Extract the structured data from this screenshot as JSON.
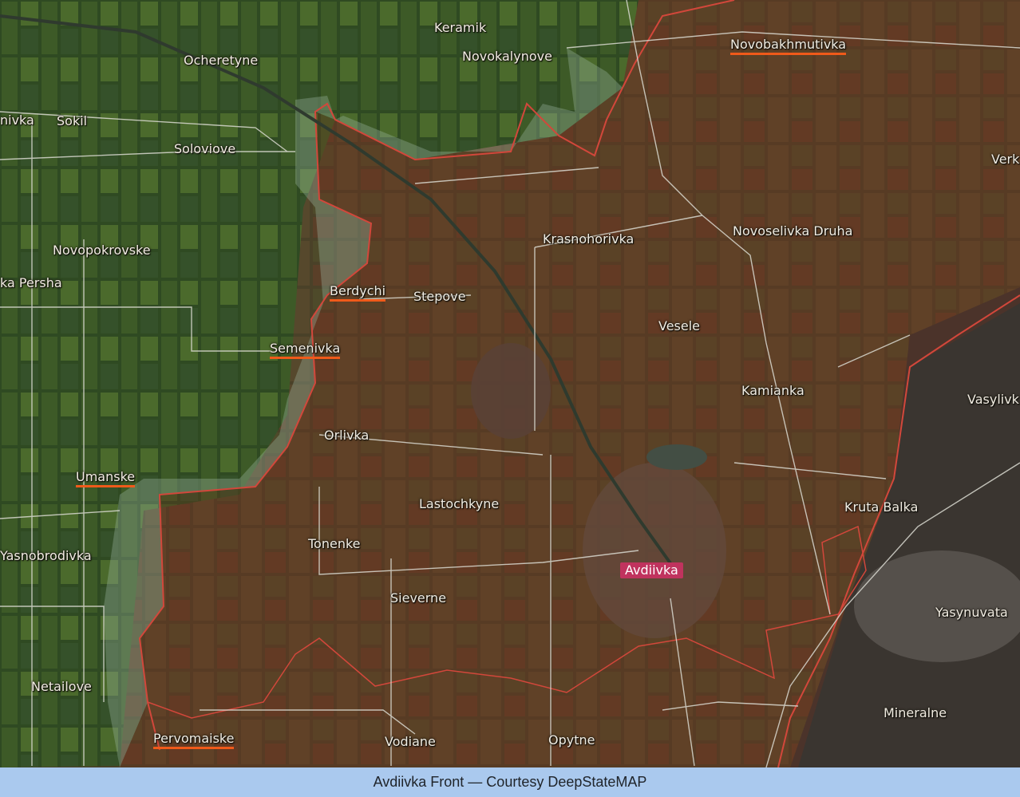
{
  "caption": "Avdiivka Front — Courtesy DeepStateMAP",
  "colors": {
    "frontline": "#d2473b",
    "occupied_fill": "#7a2e1e",
    "contested_fill": "#9fb7a2",
    "roads": "#d9d9d0",
    "highlight_underline": "#f05a1a",
    "marker": "#c0335e"
  },
  "places": [
    {
      "id": "keramik",
      "text": "Keramik",
      "style": "normal"
    },
    {
      "id": "novokalynove",
      "text": "Novokalynove",
      "style": "normal"
    },
    {
      "id": "ocheretyne",
      "text": "Ocheretyne",
      "style": "normal"
    },
    {
      "id": "novobakhmutivka",
      "text": "Novobakhmutivka",
      "style": "highlight"
    },
    {
      "id": "ivka",
      "text": "nivka",
      "style": "normal"
    },
    {
      "id": "sokil",
      "text": "Sokil",
      "style": "normal"
    },
    {
      "id": "soloviove",
      "text": "Soloviove",
      "style": "normal"
    },
    {
      "id": "verk",
      "text": "Verk",
      "style": "normal"
    },
    {
      "id": "krasnohorivka",
      "text": "Krasnohorivka",
      "style": "normal"
    },
    {
      "id": "novoselivka_druha",
      "text": "Novoselivka Druha",
      "style": "normal"
    },
    {
      "id": "novopokrovske",
      "text": "Novopokrovske",
      "style": "normal"
    },
    {
      "id": "persha",
      "text": "ka Persha",
      "style": "normal"
    },
    {
      "id": "berdychi",
      "text": "Berdychi",
      "style": "highlight"
    },
    {
      "id": "stepove",
      "text": "Stepove",
      "style": "normal"
    },
    {
      "id": "vesele",
      "text": "Vesele",
      "style": "normal"
    },
    {
      "id": "semenivka",
      "text": "Semenivka",
      "style": "highlight"
    },
    {
      "id": "kamianka",
      "text": "Kamianka",
      "style": "normal"
    },
    {
      "id": "vasylivka",
      "text": "Vasylivk",
      "style": "normal"
    },
    {
      "id": "orlivka",
      "text": "Orlivka",
      "style": "normal"
    },
    {
      "id": "umanske",
      "text": "Umanske",
      "style": "highlight"
    },
    {
      "id": "lastochkyne",
      "text": "Lastochkyne",
      "style": "normal"
    },
    {
      "id": "kruta_balka",
      "text": "Kruta Balka",
      "style": "normal"
    },
    {
      "id": "tonenke",
      "text": "Tonenke",
      "style": "normal"
    },
    {
      "id": "yasnobrodivka",
      "text": "Yasnobrodivka",
      "style": "normal"
    },
    {
      "id": "avdiivka",
      "text": "Avdiivka",
      "style": "marker"
    },
    {
      "id": "sieverne",
      "text": "Sieverne",
      "style": "normal"
    },
    {
      "id": "yasynuvata",
      "text": "Yasynuvata",
      "style": "normal"
    },
    {
      "id": "netailove",
      "text": "Netailove",
      "style": "normal"
    },
    {
      "id": "mineralne",
      "text": "Mineralne",
      "style": "normal"
    },
    {
      "id": "pervomaiske",
      "text": "Pervomaiske",
      "style": "highlight"
    },
    {
      "id": "vodiane",
      "text": "Vodiane",
      "style": "normal"
    },
    {
      "id": "opytne",
      "text": "Opytne",
      "style": "normal"
    }
  ]
}
